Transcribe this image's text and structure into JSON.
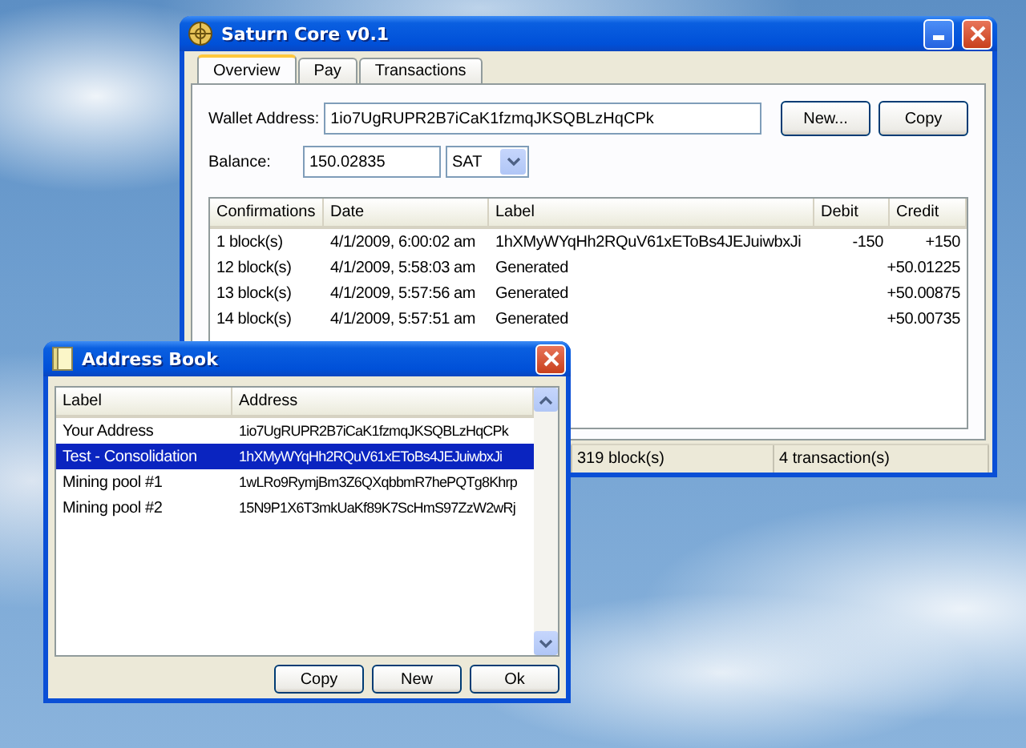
{
  "main_window": {
    "title": "Saturn Core v0.1",
    "tabs": [
      {
        "label": "Overview",
        "selected": true
      },
      {
        "label": "Pay",
        "selected": false
      },
      {
        "label": "Transactions",
        "selected": false
      }
    ],
    "wallet_address": {
      "label": "Wallet Address:",
      "value": "1io7UgRUPR2B7iCaK1fzmqJKSQBLzHqCPk"
    },
    "address_buttons": [
      "New...",
      "Copy"
    ],
    "balance": {
      "label": "Balance:",
      "value": "150.02835",
      "unit": "SAT"
    },
    "transactions": {
      "columns": [
        "Confirmations",
        "Date",
        "Label",
        "Debit",
        "Credit"
      ],
      "rows": [
        {
          "confirmations": "1 block(s)",
          "date": "4/1/2009, 6:00:02 am",
          "label": "1hXMyWYqHh2RQuV61xEToBs4JEJuiwbxJi",
          "debit": "-150",
          "credit": "+150"
        },
        {
          "confirmations": "12 block(s)",
          "date": "4/1/2009, 5:58:03 am",
          "label": "Generated",
          "credit": "+50.01225"
        },
        {
          "confirmations": "13 block(s)",
          "date": "4/1/2009, 5:57:56 am",
          "label": "Generated",
          "credit": "+50.00875"
        },
        {
          "confirmations": "14 block(s)",
          "date": "4/1/2009, 5:57:51 am",
          "label": "Generated",
          "credit": "+50.00735"
        }
      ]
    },
    "status_bar": [
      "319 block(s)",
      "4 transaction(s)"
    ]
  },
  "address_book": {
    "title": "Address Book",
    "columns": [
      "Label",
      "Address"
    ],
    "rows": [
      {
        "label": "Your Address",
        "address": "1io7UgRUPR2B7iCaK1fzmqJKSQBLzHqCPk",
        "selected": false
      },
      {
        "label": "Test - Consolidation",
        "address": "1hXMyWYqHh2RQuV61xEToBs4JEJuiwbxJi",
        "selected": true
      },
      {
        "label": "Mining pool #1",
        "address": "1wLRo9RymjBm3Z6QXqbbmR7hePQTg8Khrp",
        "selected": false
      },
      {
        "label": "Mining pool #2",
        "address": "15N9P1X6T3mkUaKf89K7ScHmS97ZzW2wRj",
        "selected": false
      }
    ],
    "buttons": [
      "Copy",
      "New",
      "Ok"
    ]
  }
}
